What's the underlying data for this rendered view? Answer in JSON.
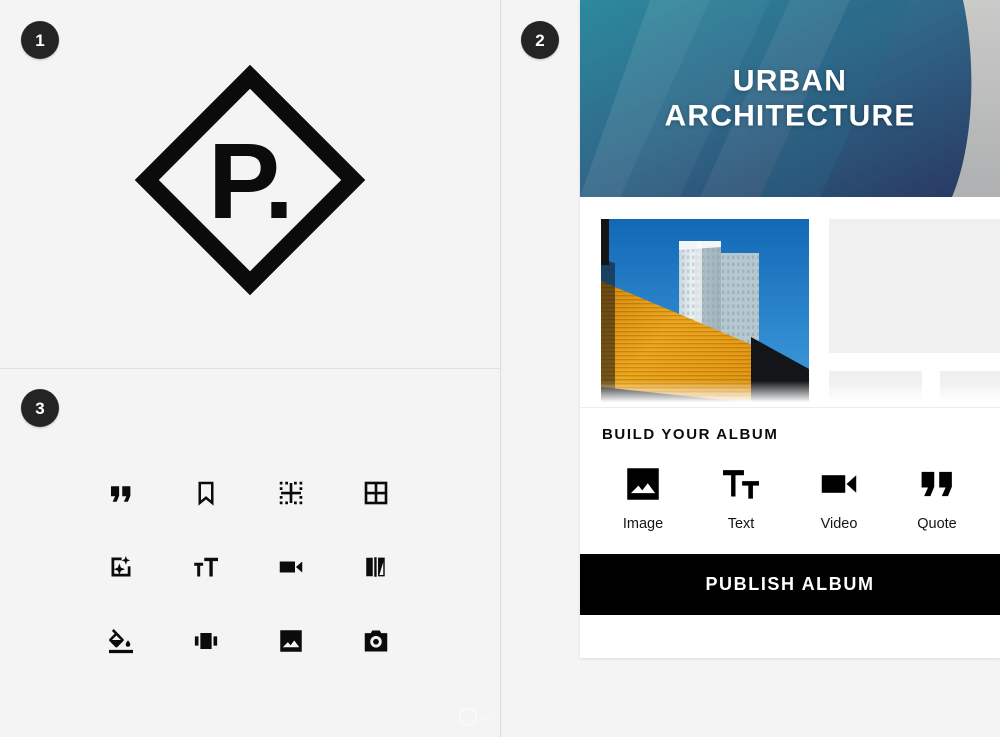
{
  "panels": {
    "badge_one": "1",
    "badge_two": "2",
    "badge_three": "3"
  },
  "logo": {
    "monogram": "P.",
    "shape": "diamond-outline",
    "color": "#0b0b0b"
  },
  "icon_grid": {
    "items": [
      {
        "name": "quote-icon",
        "label": "Quote"
      },
      {
        "name": "bookmark-icon",
        "label": "Bookmark"
      },
      {
        "name": "crop-guides-icon",
        "label": "Grid Guides"
      },
      {
        "name": "grid-four-icon",
        "label": "Grid"
      },
      {
        "name": "auto-enhance-icon",
        "label": "Auto Enhance"
      },
      {
        "name": "text-size-icon",
        "label": "Text Size"
      },
      {
        "name": "video-icon",
        "label": "Video"
      },
      {
        "name": "flip-icon",
        "label": "Flip"
      },
      {
        "name": "fill-color-icon",
        "label": "Fill Color"
      },
      {
        "name": "carousel-icon",
        "label": "Carousel"
      },
      {
        "name": "image-icon",
        "label": "Image"
      },
      {
        "name": "camera-icon",
        "label": "Camera"
      }
    ]
  },
  "album_card": {
    "hero": {
      "title_line_1": "URBAN",
      "title_line_2": "ARCHITECTURE",
      "gradient_from": "#2e93a8",
      "gradient_to": "#2c3f6b"
    },
    "photo": {
      "name": "skyscraper-photo",
      "sky_color": "#1f80cf",
      "facade_color": "#e8a01c",
      "tower_color": "#b9cdd4",
      "shadow_color": "#111318"
    },
    "placeholders": [
      {
        "name": "placeholder-main"
      },
      {
        "name": "placeholder-small-a"
      },
      {
        "name": "placeholder-small-b"
      }
    ],
    "build_section": {
      "title": "BUILD YOUR ALBUM",
      "items": [
        {
          "icon": "image-icon",
          "label": "Image"
        },
        {
          "icon": "text-size-icon",
          "label": "Text"
        },
        {
          "icon": "video-icon",
          "label": "Video"
        },
        {
          "icon": "quote-icon",
          "label": "Quote"
        }
      ]
    },
    "publish_label": "PUBLISH ALBUM"
  }
}
